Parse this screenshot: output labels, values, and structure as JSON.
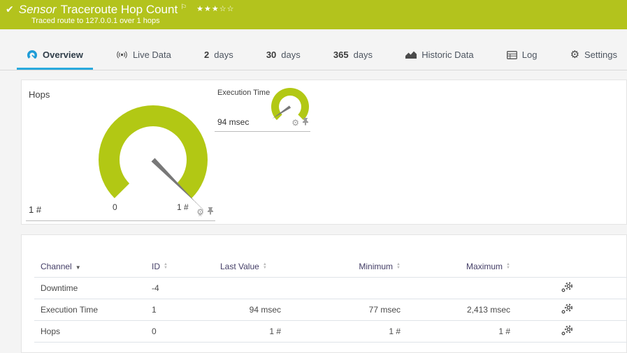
{
  "header": {
    "check": "✔",
    "kind": "Sensor",
    "title": "Traceroute Hop Count",
    "flag": "⚐",
    "stars_filled": "★★★",
    "stars_empty": "☆☆",
    "subtitle": "Traced route to 127.0.0.1 over 1 hops"
  },
  "tabs": [
    {
      "label": "Overview",
      "active": true
    },
    {
      "label": "Live Data"
    },
    {
      "prefix": "2",
      "label": "days"
    },
    {
      "prefix": "30",
      "label": "days"
    },
    {
      "prefix": "365",
      "label": "days"
    },
    {
      "label": "Historic Data"
    },
    {
      "label": "Log"
    },
    {
      "label": "Settings"
    }
  ],
  "gauges": {
    "hops": {
      "label": "Hops",
      "value": "1 #",
      "scale_min": "0",
      "scale_max": "1 #"
    },
    "execution_time": {
      "label": "Execution Time",
      "value": "94 msec"
    }
  },
  "table": {
    "columns": {
      "channel": "Channel",
      "id": "ID",
      "last_value": "Last Value",
      "minimum": "Minimum",
      "maximum": "Maximum"
    },
    "rows": [
      {
        "channel": "Downtime",
        "id": "-4",
        "last_value": "",
        "minimum": "",
        "maximum": ""
      },
      {
        "channel": "Execution Time",
        "id": "1",
        "last_value": "94 msec",
        "minimum": "77 msec",
        "maximum": "2,413 msec"
      },
      {
        "channel": "Hops",
        "id": "0",
        "last_value": "1 #",
        "minimum": "1 #",
        "maximum": "1 #"
      }
    ]
  },
  "colors": {
    "header_bg": "#b3c31d",
    "gauge_green": "#b2c814",
    "accent_blue": "#29a9dd",
    "needle_gray": "#787878",
    "page_bg": "#f4f4f4"
  }
}
